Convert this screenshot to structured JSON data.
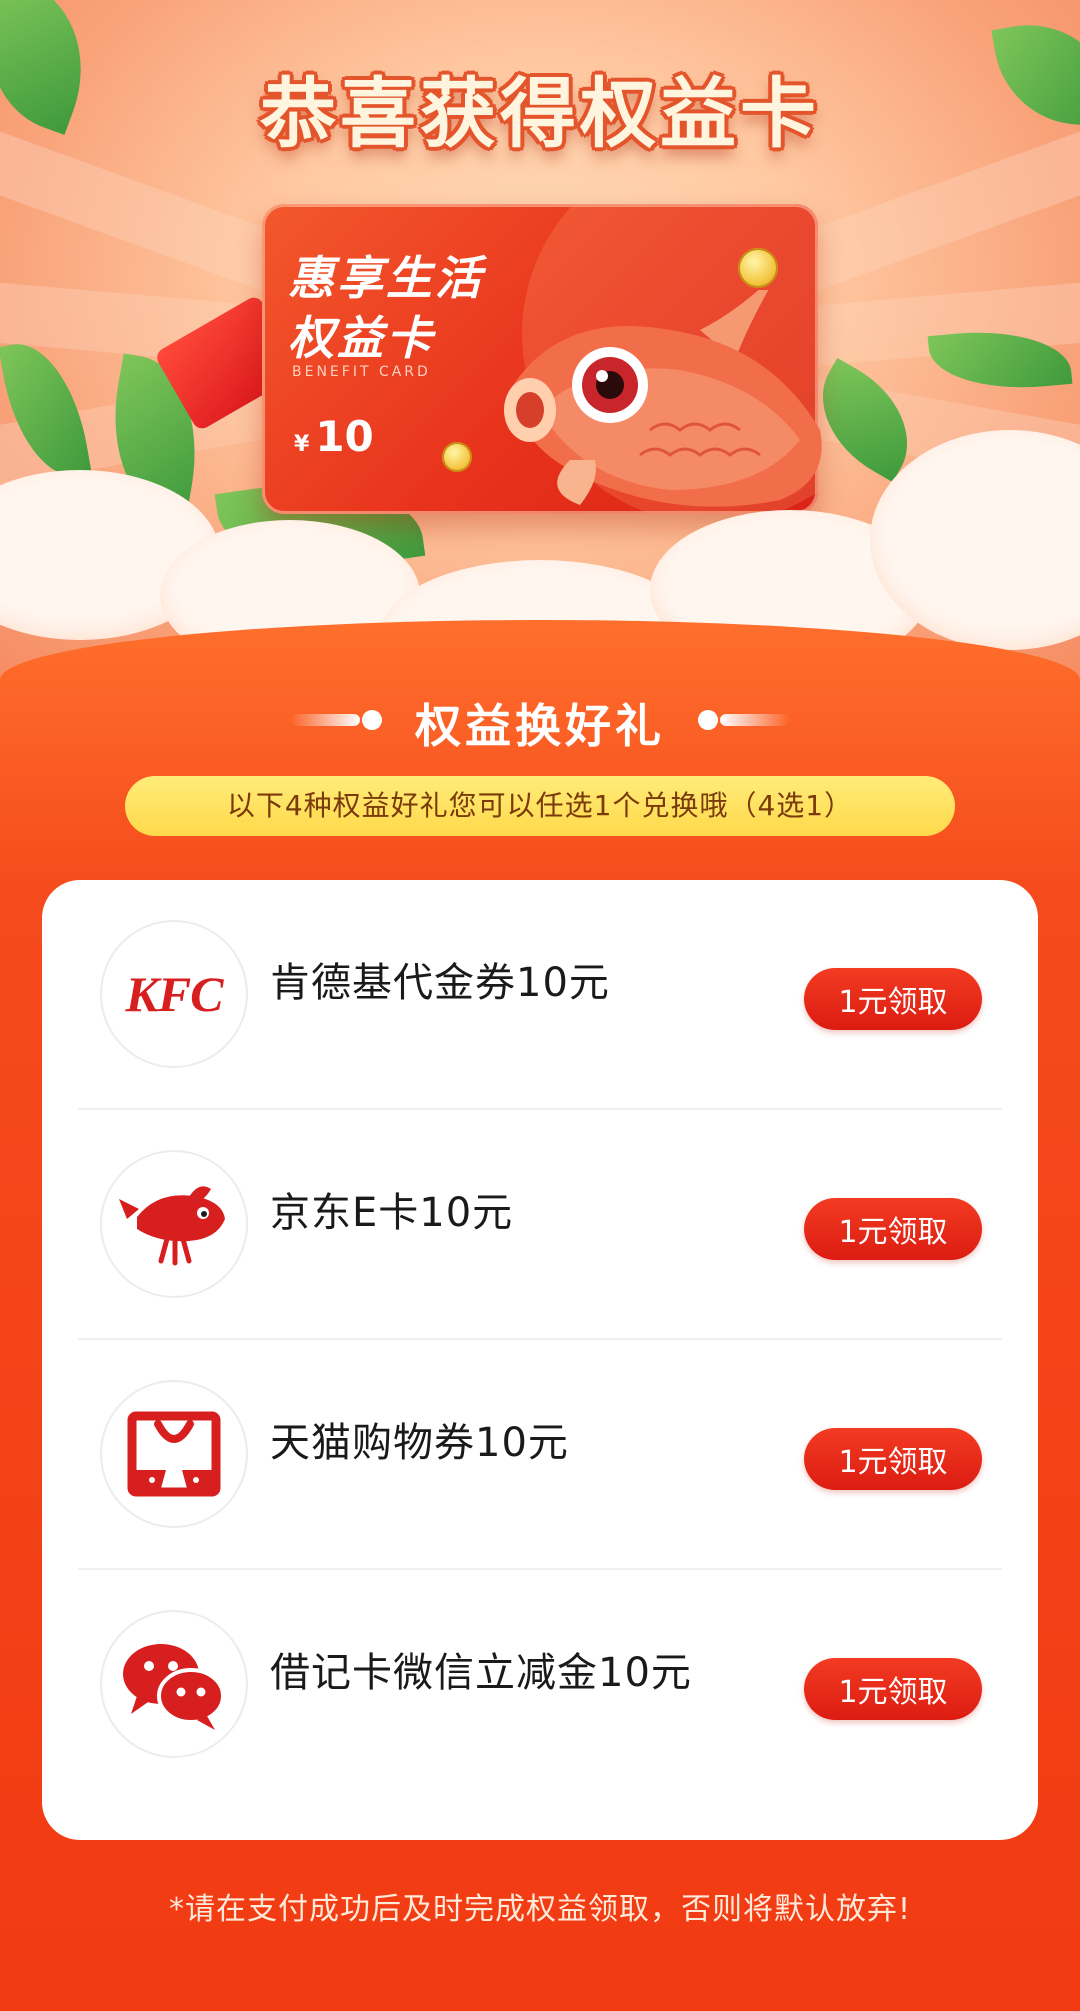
{
  "hero": {
    "title": "恭喜获得权益卡"
  },
  "benefit_card": {
    "title_line1": "惠享生活",
    "title_line2": "权益卡",
    "subtitle": "BENEFIT CARD",
    "currency": "¥",
    "amount": "10"
  },
  "section": {
    "title": "权益换好礼",
    "notice": "以下4种权益好礼您可以任选1个兑换哦（4选1）"
  },
  "rewards": [
    {
      "name": "肯德基代金券10元",
      "button": "1元领取",
      "logo": "kfc-logo",
      "logo_text": "KFC"
    },
    {
      "name": "京东E卡10元",
      "button": "1元领取",
      "logo": "jd-dog-logo"
    },
    {
      "name": "天猫购物券10元",
      "button": "1元领取",
      "logo": "tmall-bag-logo"
    },
    {
      "name": "借记卡微信立减金10元",
      "button": "1元领取",
      "logo": "wechat-logo"
    }
  ],
  "footer": {
    "note": "*请在支付成功后及时完成权益领取，否则将默认放弃!"
  },
  "colors": {
    "primary_red": "#dc1c12",
    "orange_bg": "#f23a12",
    "notice_yellow": "#ffd94a",
    "brand_red": "#d71f1f"
  }
}
